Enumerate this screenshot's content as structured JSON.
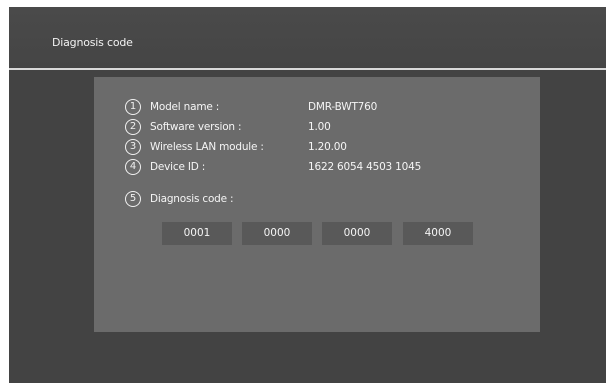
{
  "header": {
    "title": "Diagnosis code"
  },
  "info": {
    "items": [
      {
        "number": "1",
        "label": "Model name :",
        "value": "DMR-BWT760"
      },
      {
        "number": "2",
        "label": "Software version :",
        "value": "1.00"
      },
      {
        "number": "3",
        "label": "Wireless LAN module :",
        "value": "1.20.00"
      },
      {
        "number": "4",
        "label": "Device ID :",
        "value": "1622 6054 4503 1045"
      },
      {
        "number": "5",
        "label": "Diagnosis code :"
      }
    ]
  },
  "diagnosis_codes": [
    "0001",
    "0000",
    "0000",
    "4000"
  ],
  "colors": {
    "screen_background": "#434343",
    "panel_background": "#6b6b6b",
    "code_box_background": "#595959",
    "divider": "#d9d9d9",
    "text": "#f5f5f5"
  }
}
